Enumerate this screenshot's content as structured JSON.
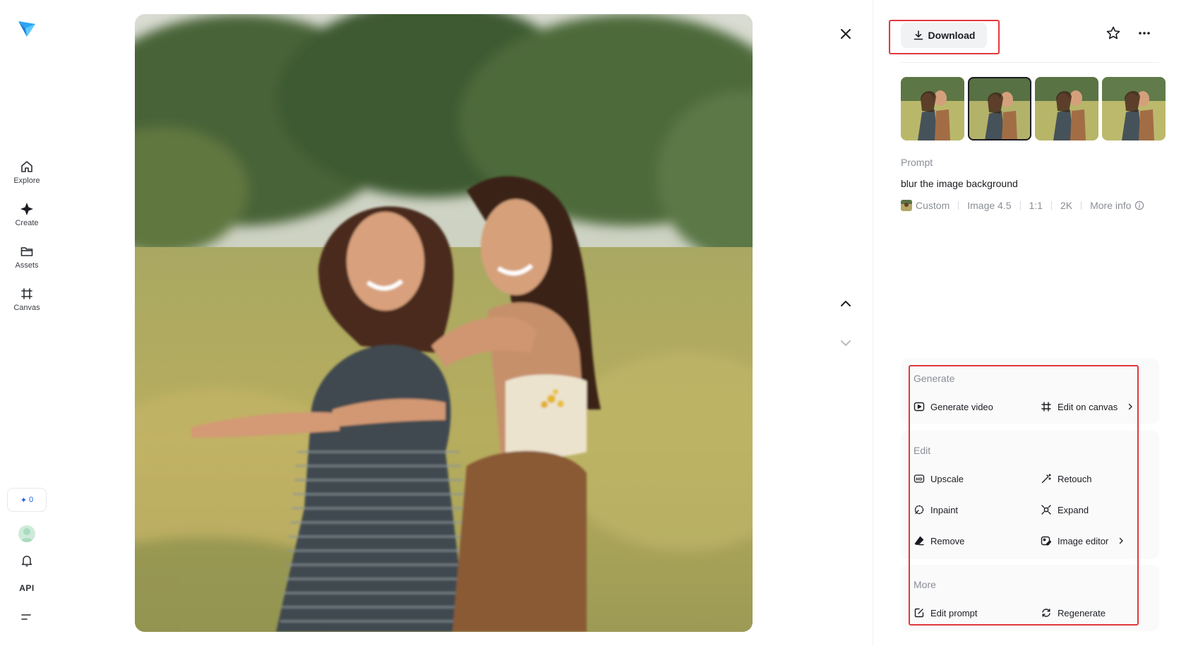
{
  "sidebar": {
    "items": [
      {
        "label": "Explore",
        "icon": "home-icon"
      },
      {
        "label": "Create",
        "icon": "sparkle-icon"
      },
      {
        "label": "Assets",
        "icon": "folder-icon"
      },
      {
        "label": "Canvas",
        "icon": "canvas-icon"
      }
    ],
    "credits": "0",
    "api_label": "API"
  },
  "toolbar": {
    "download_label": "Download"
  },
  "details": {
    "prompt_label": "Prompt",
    "prompt_text": "blur the image background",
    "meta": {
      "style": "Custom",
      "model": "Image 4.5",
      "ratio": "1:1",
      "resolution": "2K",
      "more_info": "More info"
    }
  },
  "actions": {
    "generate": {
      "label": "Generate",
      "items": [
        {
          "label": "Generate video",
          "icon": "play-square-icon"
        },
        {
          "label": "Edit on canvas",
          "icon": "canvas-icon"
        }
      ]
    },
    "edit": {
      "label": "Edit",
      "items": [
        {
          "label": "Upscale",
          "icon": "hd-icon"
        },
        {
          "label": "Retouch",
          "icon": "magic-wand-icon"
        },
        {
          "label": "Inpaint",
          "icon": "brush-icon"
        },
        {
          "label": "Expand",
          "icon": "expand-icon"
        },
        {
          "label": "Remove",
          "icon": "eraser-icon"
        },
        {
          "label": "Image editor",
          "icon": "image-edit-icon"
        }
      ]
    },
    "more": {
      "label": "More",
      "items": [
        {
          "label": "Edit prompt",
          "icon": "edit-square-icon"
        },
        {
          "label": "Regenerate",
          "icon": "refresh-icon"
        }
      ]
    }
  },
  "colors": {
    "accent_blue": "#1d62e6",
    "highlight_red": "#e0393e",
    "muted_text": "#8a8e96"
  }
}
